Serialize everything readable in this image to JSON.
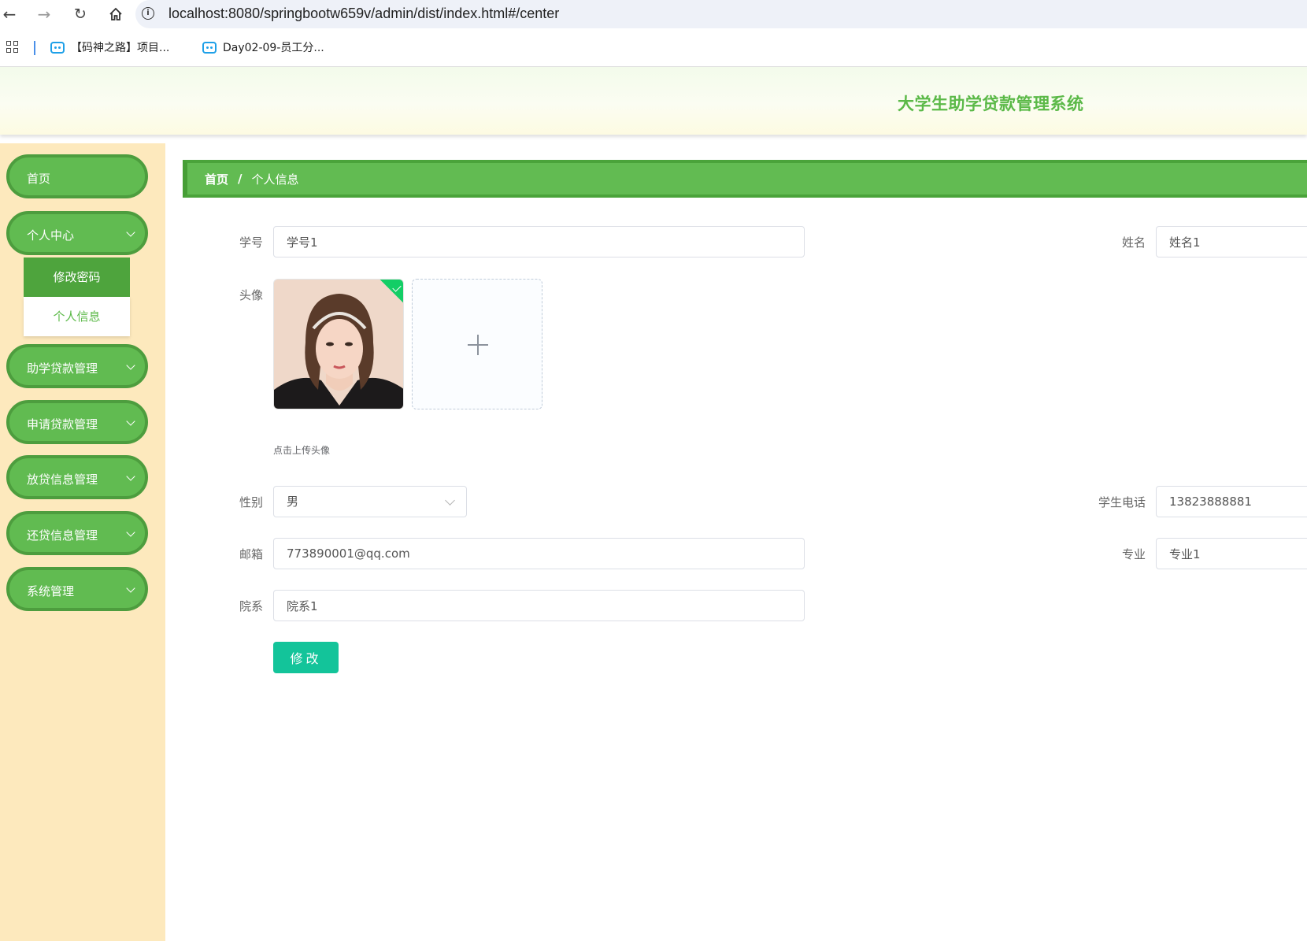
{
  "browser": {
    "url": "localhost:8080/springbootw659v/admin/dist/index.html#/center",
    "bookmarks": [
      "【码神之路】项目...",
      "Day02-09-员工分..."
    ]
  },
  "header": {
    "title": "大学生助学贷款管理系统"
  },
  "sidebar": {
    "items": [
      {
        "label": "首页"
      },
      {
        "label": "个人中心"
      },
      {
        "label": "助学贷款管理"
      },
      {
        "label": "申请贷款管理"
      },
      {
        "label": "放贷信息管理"
      },
      {
        "label": "还贷信息管理"
      },
      {
        "label": "系统管理"
      }
    ],
    "submenu": [
      "修改密码",
      "个人信息"
    ]
  },
  "breadcrumb": {
    "home": "首页",
    "separator": "/",
    "current": "个人信息"
  },
  "form": {
    "student_no": {
      "label": "学号",
      "value": "学号1"
    },
    "name": {
      "label": "姓名",
      "value": "姓名1"
    },
    "avatar": {
      "label": "头像",
      "tip": "点击上传头像"
    },
    "gender": {
      "label": "性别",
      "value": "男"
    },
    "phone": {
      "label": "学生电话",
      "value": "13823888881"
    },
    "email": {
      "label": "邮箱",
      "value": "773890001@qq.com"
    },
    "major": {
      "label": "专业",
      "value": "专业1"
    },
    "department": {
      "label": "院系",
      "value": "院系1"
    },
    "submit_label": "修改"
  },
  "colors": {
    "accent": "#61bb51",
    "submit": "#13c49a",
    "sidebar_bg": "#fde9bd"
  }
}
